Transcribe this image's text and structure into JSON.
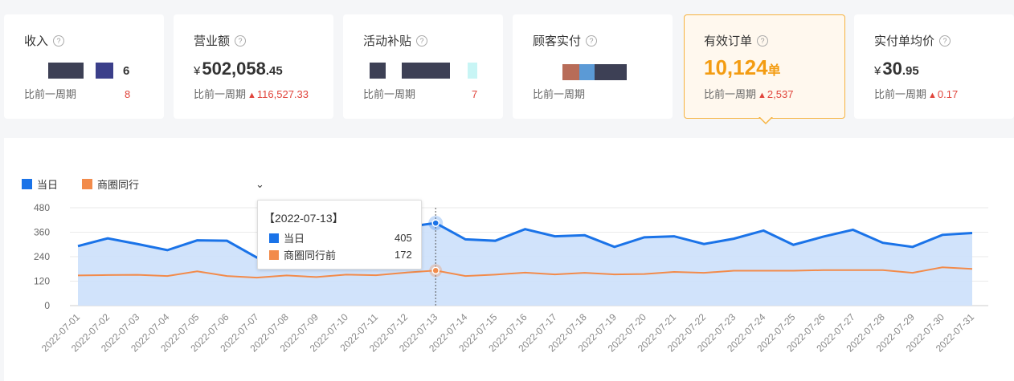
{
  "cards": [
    {
      "title": "收入",
      "currency": "",
      "int": "",
      "dec": "6",
      "unit": "",
      "compare_label": "比前一周期",
      "compare_value": "8",
      "active": false
    },
    {
      "title": "营业额",
      "currency": "¥",
      "int": "502,058",
      "dec": ".45",
      "unit": "",
      "compare_label": "比前一周期",
      "compare_value": "116,527.33",
      "active": false
    },
    {
      "title": "活动补贴",
      "currency": "",
      "int": "",
      "dec": "",
      "unit": "",
      "compare_label": "比前一周期",
      "compare_value": "7",
      "active": false
    },
    {
      "title": "顾客实付",
      "currency": "",
      "int": "",
      "dec": "",
      "unit": "",
      "compare_label": "比前一周期",
      "compare_value": "",
      "active": false
    },
    {
      "title": "有效订单",
      "currency": "",
      "int": "10,124",
      "dec": "",
      "unit": "单",
      "compare_label": "比前一周期",
      "compare_value": "2,537",
      "active": true
    },
    {
      "title": "实付单均价",
      "currency": "¥",
      "int": "30",
      "dec": ".95",
      "unit": "",
      "compare_label": "比前一周期",
      "compare_value": "0.17",
      "active": false
    }
  ],
  "colors": {
    "series1": "#1a73e8",
    "series2": "#f28b4b",
    "area": "#cfe1fb",
    "active_border": "#f6b340",
    "active_value": "#f39c12",
    "up": "#e0443b"
  },
  "legend": {
    "chevron": "⌄"
  },
  "tooltip": {
    "title": "【2022-07-13】",
    "rows": [
      {
        "label": "当日",
        "value": "405"
      },
      {
        "label": "商圈同行前",
        "value": "172"
      }
    ]
  },
  "chart_data": {
    "type": "line",
    "x": [
      "2022-07-01",
      "2022-07-02",
      "2022-07-03",
      "2022-07-04",
      "2022-07-05",
      "2022-07-06",
      "2022-07-07",
      "2022-07-08",
      "2022-07-09",
      "2022-07-10",
      "2022-07-11",
      "2022-07-12",
      "2022-07-13",
      "2022-07-14",
      "2022-07-15",
      "2022-07-16",
      "2022-07-17",
      "2022-07-18",
      "2022-07-19",
      "2022-07-20",
      "2022-07-21",
      "2022-07-22",
      "2022-07-23",
      "2022-07-24",
      "2022-07-25",
      "2022-07-26",
      "2022-07-27",
      "2022-07-28",
      "2022-07-29",
      "2022-07-30",
      "2022-07-31"
    ],
    "series": [
      {
        "name": "当日",
        "fill": "area",
        "values": [
          292,
          330,
          302,
          272,
          320,
          318,
          236,
          268,
          286,
          250,
          258,
          385,
          405,
          325,
          318,
          375,
          340,
          345,
          288,
          335,
          340,
          302,
          328,
          368,
          298,
          338,
          372,
          308,
          288,
          347,
          356
        ]
      },
      {
        "name": "商圈同行",
        "values": [
          148,
          150,
          151,
          145,
          168,
          145,
          137,
          148,
          140,
          152,
          149,
          162,
          172,
          145,
          152,
          162,
          153,
          161,
          153,
          155,
          165,
          161,
          171,
          171,
          171,
          174,
          174,
          174,
          161,
          188,
          180
        ]
      }
    ],
    "ylim": [
      0,
      480
    ],
    "yticks": [
      0,
      120,
      240,
      360,
      480
    ],
    "highlight_index": 12,
    "grid": true,
    "legend_position": "top-left"
  }
}
